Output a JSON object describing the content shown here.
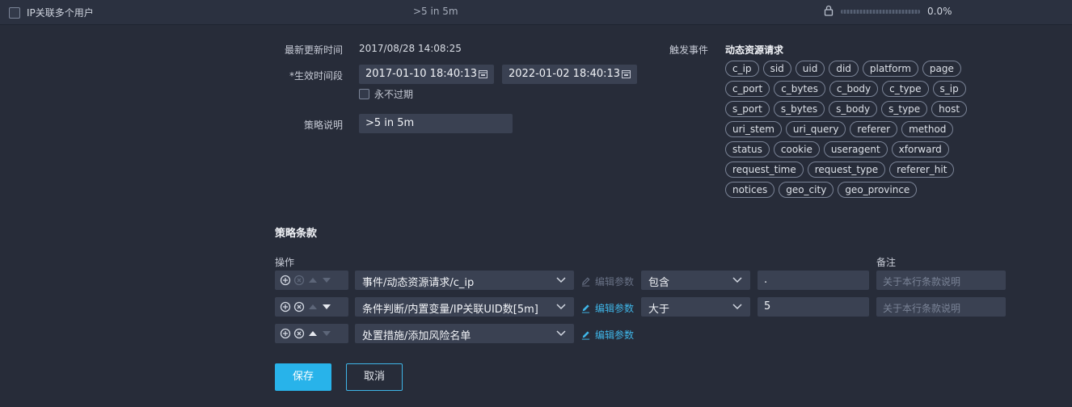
{
  "header": {
    "title": "IP关联多个用户",
    "description": ">5 in 5m",
    "progress_percent": 0,
    "progress_text": "0.0%"
  },
  "form": {
    "last_update_label": "最新更新时间",
    "last_update_value": "2017/08/28 14:08:25",
    "effective_label": "*生效时间段",
    "start_time": "2017-01-10 18:40:13",
    "end_time": "2022-01-02 18:40:13",
    "never_expire_label": "永不过期",
    "desc_label": "策略说明",
    "desc_value": ">5 in 5m"
  },
  "events": {
    "label": "触发事件",
    "title": "动态资源请求",
    "tags": [
      "c_ip",
      "sid",
      "uid",
      "did",
      "platform",
      "page",
      "c_port",
      "c_bytes",
      "c_body",
      "c_type",
      "s_ip",
      "s_port",
      "s_bytes",
      "s_body",
      "s_type",
      "host",
      "uri_stem",
      "uri_query",
      "referer",
      "method",
      "status",
      "cookie",
      "useragent",
      "xforward",
      "request_time",
      "request_type",
      "referer_hit",
      "notices",
      "geo_city",
      "geo_province"
    ]
  },
  "clauses": {
    "title": "策略条款",
    "op_label": "操作",
    "note_label": "备注",
    "edit_label": "编辑参数",
    "rows": [
      {
        "source": "事件/动态资源请求/c_ip",
        "operator": "包含",
        "value": ".",
        "note_placeholder": "关于本行条款说明"
      },
      {
        "source": "条件判断/内置变量/IP关联UID数[5m]",
        "operator": "大于",
        "value": "5",
        "note_placeholder": "关于本行条款说明"
      },
      {
        "source": "处置措施/添加风险名单"
      }
    ]
  },
  "buttons": {
    "save": "保存",
    "cancel": "取消"
  },
  "colors": {
    "accent": "#28b3ea",
    "background": "#272c39",
    "field": "#3a4152"
  }
}
